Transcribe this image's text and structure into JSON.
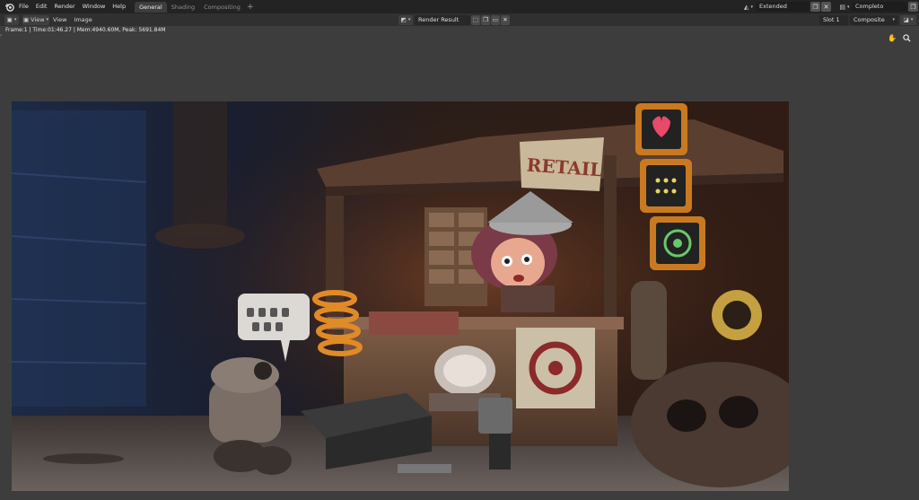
{
  "menu": {
    "items": [
      "File",
      "Edit",
      "Render",
      "Window",
      "Help"
    ]
  },
  "workspaces": {
    "tabs": [
      "General",
      "Shading",
      "Compositing"
    ],
    "active": "General",
    "add_label": "+"
  },
  "scene": {
    "scene_name": "Extended",
    "view_layer": "Completo"
  },
  "editor": {
    "menus": [
      "View",
      "View",
      "Image"
    ],
    "image_name": "Render Result",
    "slot": "Slot 1",
    "pass": "Composite"
  },
  "status": {
    "text": "Frame:1 | Time:01:46.27 | Mem:4940.60M, Peak: 5691.84M"
  },
  "render_image": {
    "sign_text": "RETAIL"
  },
  "colors": {
    "topbar": "#232323",
    "header": "#303030",
    "editor_bg": "#3d3d3d",
    "active_tab": "#3d3d3d"
  },
  "icons": {
    "logo": "blender-logo-icon",
    "editor_type": "image-editor-icon",
    "hand": "hand-pan-icon",
    "zoom": "zoom-icon"
  }
}
